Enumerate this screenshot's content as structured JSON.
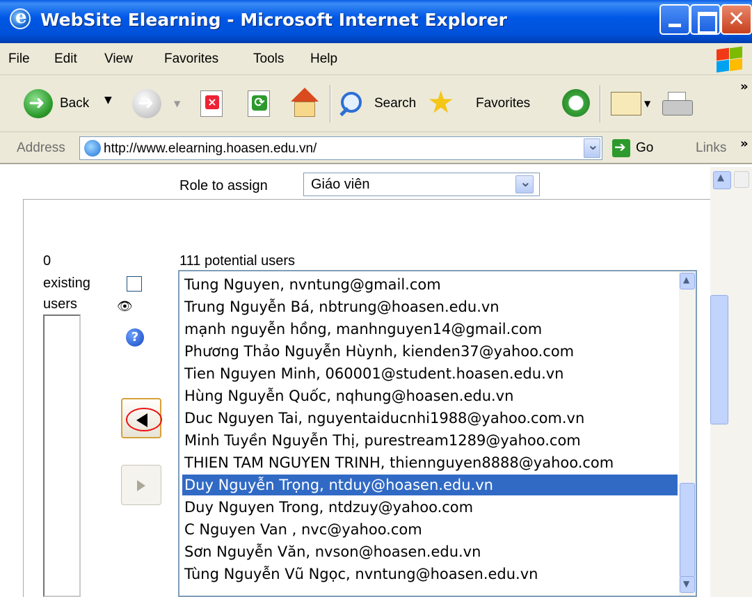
{
  "window": {
    "title": "WebSite Elearning - Microsoft Internet Explorer"
  },
  "menu": [
    "File",
    "Edit",
    "View",
    "Favorites",
    "Tools",
    "Help"
  ],
  "toolbar": {
    "back": "Back",
    "search": "Search",
    "favorites": "Favorites"
  },
  "address": {
    "label": "Address",
    "url": "http://www.elearning.hoasen.edu.vn/",
    "go": "Go",
    "links": "Links"
  },
  "form": {
    "role_label": "Role to assign",
    "role_value": "Giáo viên",
    "existing_count": "0",
    "existing_label_1": "existing",
    "existing_label_2": "users",
    "potential_label": "111 potential users",
    "potential_users": [
      "Tung Nguyen, nvntung@gmail.com",
      "Trung Nguyễn Bá, nbtrung@hoasen.edu.vn",
      "mạnh nguyễn hồng, manhnguyen14@gmail.com",
      "Phương Thảo Nguyễn Hùynh, kienden37@yahoo.com",
      "Tien Nguyen Minh, 060001@student.hoasen.edu.vn",
      "Hùng Nguyễn Quốc, nqhung@hoasen.edu.vn",
      "Duc Nguyen Tai, nguyentaiducnhi1988@yahoo.com.vn",
      "Minh Tuyền Nguyễn Thị, purestream1289@yahoo.com",
      "THIEN TAM NGUYEN TRINH, thiennguyen8888@yahoo.com",
      "Duy Nguyễn Trọng, ntduy@hoasen.edu.vn",
      "Duy Nguyen Trong, ntdzuy@yahoo.com",
      "C Nguyen Van , nvc@yahoo.com",
      "Sơn Nguyễn Văn, nvson@hoasen.edu.vn",
      "Tùng Nguyễn Vũ Ngọc, nvntung@hoasen.edu.vn"
    ],
    "selected_index": 9
  }
}
